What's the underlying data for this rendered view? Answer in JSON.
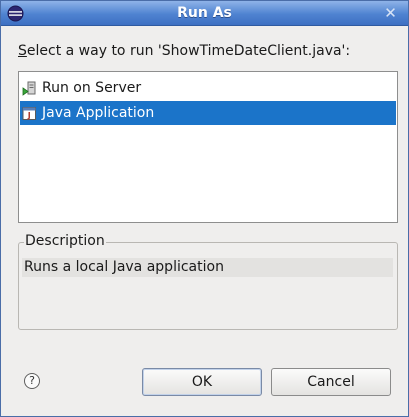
{
  "window": {
    "title": "Run As",
    "close_glyph": "✕",
    "app_icon": "eclipse-icon"
  },
  "prompt": {
    "mnemonic": "S",
    "rest": "elect a way to run 'ShowTimeDateClient.java':"
  },
  "run_options": [
    {
      "label": "Run on Server",
      "icon": "run-on-server-icon",
      "selected": false
    },
    {
      "label": "Java Application",
      "icon": "java-application-icon",
      "selected": true
    }
  ],
  "description": {
    "group_label": "Description",
    "text": "Runs a local Java application"
  },
  "buttons": {
    "help_glyph": "?",
    "ok_label": "OK",
    "cancel_label": "Cancel"
  },
  "colors": {
    "selection": "#1b74c9",
    "titlebar": "#4f83d1",
    "dialog_background": "#efeeed"
  }
}
